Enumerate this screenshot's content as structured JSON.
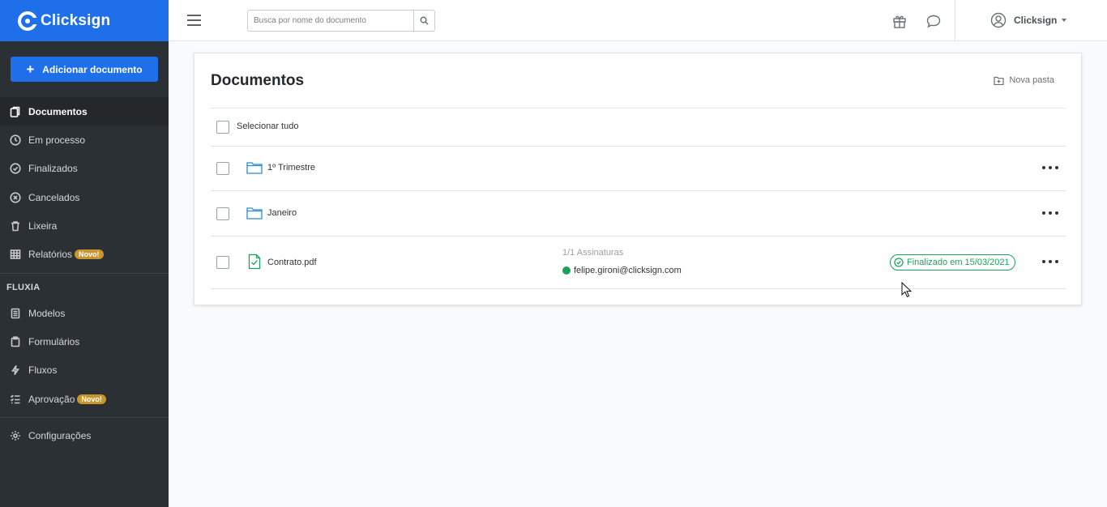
{
  "brand": {
    "name": "Clicksign",
    "color": "#1f6feb"
  },
  "sidebar": {
    "add_button": "Adicionar documento",
    "items": [
      {
        "label": "Documentos",
        "icon": "documents-icon"
      },
      {
        "label": "Em processo",
        "icon": "clock-icon"
      },
      {
        "label": "Finalizados",
        "icon": "check-circle-icon"
      },
      {
        "label": "Cancelados",
        "icon": "x-circle-icon"
      },
      {
        "label": "Lixeira",
        "icon": "trash-icon"
      },
      {
        "label": "Relatórios",
        "icon": "table-icon",
        "badge": "Novo!"
      }
    ],
    "section_title": "FLUXIA",
    "fluxia_items": [
      {
        "label": "Modelos",
        "icon": "template-icon"
      },
      {
        "label": "Formulários",
        "icon": "clipboard-icon"
      },
      {
        "label": "Fluxos",
        "icon": "bolt-icon"
      },
      {
        "label": "Aprovação",
        "icon": "checklist-icon",
        "badge": "Novo!"
      }
    ],
    "settings": {
      "label": "Configurações",
      "icon": "gear-icon"
    }
  },
  "topbar": {
    "search_placeholder": "Busca por nome do documento",
    "user_name": "Clicksign"
  },
  "main": {
    "title": "Documentos",
    "new_folder": "Nova pasta",
    "select_all": "Selecionar tudo",
    "rows": [
      {
        "type": "folder",
        "name": "1º Trimestre"
      },
      {
        "type": "folder",
        "name": "Janeiro"
      },
      {
        "type": "file",
        "name": "Contrato.pdf",
        "signatures": "1/1 Assinaturas",
        "signer": "felipe.gironi@clicksign.com",
        "status": "Finalizado em 15/03/2021"
      }
    ]
  }
}
